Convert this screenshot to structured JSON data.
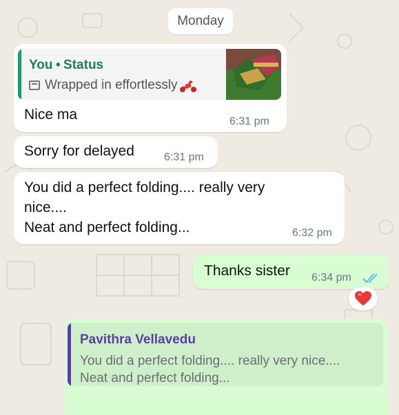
{
  "date_chip": "Monday",
  "messages": [
    {
      "quote": {
        "author": "You",
        "separator": "•",
        "kind": "Status",
        "icon": "image-icon",
        "text": "Wrapped in effortlessly",
        "emoji": "scooter-emoji"
      },
      "text": "Nice ma",
      "time": "6:31 pm"
    },
    {
      "text": "Sorry for delayed",
      "time": "6:31 pm"
    },
    {
      "line1": "You did a perfect folding.... really very",
      "line2": "nice....",
      "line3": "Neat and perfect folding...",
      "time": "6:32 pm"
    },
    {
      "text": "Thanks sister",
      "time": "6:34 pm",
      "ticks": "read-double-check-icon",
      "reaction": "heart-emoji"
    }
  ],
  "reply_draft": {
    "author": "Pavithra Vellavedu",
    "line1": "You did a perfect folding.... really very nice....",
    "line2": "Neat and perfect folding..."
  },
  "colors": {
    "background": "#efeae2",
    "incoming": "#ffffff",
    "outgoing": "#d9fdd3",
    "status_accent": "#1a7f5c",
    "reply_accent": "#5a3fa8",
    "read_ticks": "#53bdeb"
  }
}
